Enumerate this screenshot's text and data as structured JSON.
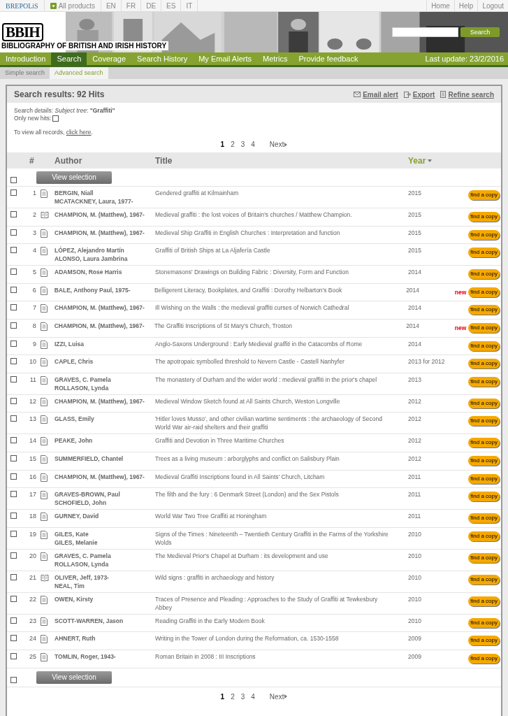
{
  "topbar": {
    "brand": "BREPOLiS",
    "products": "All products",
    "languages": [
      {
        "code": "EN",
        "selected": false
      },
      {
        "code": "FR",
        "selected": false
      },
      {
        "code": "DE",
        "selected": false
      },
      {
        "code": "ES",
        "selected": false
      },
      {
        "code": "IT",
        "selected": false
      }
    ],
    "links": [
      "Home",
      "Help",
      "Logout"
    ]
  },
  "banner": {
    "logo": "BBIH",
    "title": "BIBLIOGRAPHY OF BRITISH AND IRISH HISTORY",
    "search_button": "Search"
  },
  "nav": {
    "items": [
      {
        "label": "Introduction",
        "selected": false
      },
      {
        "label": "Search",
        "selected": true
      },
      {
        "label": "Coverage",
        "selected": false
      },
      {
        "label": "Search History",
        "selected": false
      },
      {
        "label": "My Email Alerts",
        "selected": false
      },
      {
        "label": "Metrics",
        "selected": false
      },
      {
        "label": "Provide feedback",
        "selected": false
      }
    ],
    "last_update": "Last update: 23/2/2016"
  },
  "subnav": [
    {
      "label": "Simple search",
      "selected": false
    },
    {
      "label": "Advanced search",
      "selected": true
    }
  ],
  "results": {
    "title": "Search results: 92 Hits",
    "actions": [
      {
        "kind": "mail",
        "label": "Email alert"
      },
      {
        "kind": "export",
        "label": "Export"
      },
      {
        "kind": "refine",
        "label": "Refine search"
      }
    ],
    "details": "Search details: *Subject tree*: **\"Graffiti\"**",
    "only_new_label": "Only new hits:",
    "only_new": false,
    "view_all": "To view all records, ",
    "view_all_link": "click here",
    "view_all_end": ".",
    "pages": [
      {
        "label": "1",
        "selected": true
      },
      {
        "label": "2",
        "selected": false
      },
      {
        "label": "3",
        "selected": false
      },
      {
        "label": "4",
        "selected": false
      }
    ],
    "next": "Next",
    "columns": [
      {
        "label": "#",
        "sorted": false
      },
      {
        "label": "Author",
        "sorted": false
      },
      {
        "label": "Title",
        "sorted": false
      },
      {
        "label": "Year",
        "sorted": true
      }
    ],
    "view_selection": "View selection",
    "view_selection_bottom": "View selection",
    "rows": [
      {
        "num": "1",
        "kind": "article",
        "checked": false,
        "authors": [
          "BERGIN, Niall",
          "MCATACKNEY, Laura, 1977-"
        ],
        "title": "Gendered graffiti at Kilmainham",
        "year": "2015",
        "button": "find a copy"
      },
      {
        "num": "2",
        "kind": "book",
        "checked": false,
        "authors": [
          "CHAMPION, M. (Matthew), 1967-"
        ],
        "title": "Medieval graffiti : the lost voices of Britain's churches / Matthew Champion.",
        "year": "2015",
        "button": "find a copy"
      },
      {
        "num": "3",
        "kind": "article",
        "checked": false,
        "authors": [
          "CHAMPION, M. (Matthew), 1967-"
        ],
        "title": "Medieval Ship Graffiti in English Churches : Interpretation and function",
        "year": "2015",
        "button": "find a copy"
      },
      {
        "num": "4",
        "kind": "article",
        "checked": false,
        "authors": [
          "LÓPEZ, Alejandro Martín",
          "ALONSO, Laura Jambrina"
        ],
        "title": "Graffiti of British Ships at La Aljafería Castle",
        "year": "2015",
        "button": "find a copy"
      },
      {
        "num": "5",
        "kind": "article",
        "checked": false,
        "authors": [
          "ADAMSON, Rose Harris"
        ],
        "title": "Stonemasons' Drawings on Building Fabric : Diversity, Form and Function",
        "year": "2014",
        "button": "find a copy"
      },
      {
        "num": "6",
        "kind": "article",
        "checked": false,
        "authors": [
          "BALE, Anthony Paul, 1975-"
        ],
        "title": "Belligerent Literacy, Bookplates, and Graffiti : Dorothy Helbarton's Book",
        "year": "2014",
        "badge": "new",
        "button": "find a copy"
      },
      {
        "num": "7",
        "kind": "article",
        "checked": false,
        "authors": [
          "CHAMPION, M. (Matthew), 1967-"
        ],
        "title": "Ill Wishing on the Walls : the medieval graffiti curses of Norwich Cathedral",
        "year": "2014",
        "button": "find a copy"
      },
      {
        "num": "8",
        "kind": "article",
        "checked": false,
        "authors": [
          "CHAMPION, M. (Matthew), 1967-"
        ],
        "title": "The Graffiti Inscriptions of St Mary's Church, Troston",
        "year": "2014",
        "badge": "new",
        "button": "find a copy"
      },
      {
        "num": "9",
        "kind": "article",
        "checked": false,
        "authors": [
          "IZZI, Luisa"
        ],
        "title": "Anglo-Saxons Underground : Early Medieval *graffiti* in the Catacombs of Rome",
        "year": "2014",
        "button": "find a copy"
      },
      {
        "num": "10",
        "kind": "article",
        "checked": false,
        "authors": [
          "CAPLE, Chris"
        ],
        "title": "The apotropaic symbolled threshold to Nevern Castle - Castell Nanhyfer",
        "year": "2013 for 2012",
        "button": "find a copy"
      },
      {
        "num": "11",
        "kind": "article",
        "checked": false,
        "authors": [
          "GRAVES, C. Pamela",
          "ROLLASON, Lynda"
        ],
        "title": "The monastery of Durham and the wider world : medieval graffiti in the prior's chapel",
        "year": "2013",
        "button": "find a copy"
      },
      {
        "num": "12",
        "kind": "article",
        "checked": false,
        "authors": [
          "CHAMPION, M. (Matthew), 1967-"
        ],
        "title": "Medieval Window Sketch found at All Saints Church, Weston Longville",
        "year": "2012",
        "button": "find a copy"
      },
      {
        "num": "13",
        "kind": "article",
        "checked": false,
        "authors": [
          "GLASS, Emily"
        ],
        "title": "'Hitler loves Musso', and other civilian wartime sentiments : the archaeology of Second World War air-raid shelters and their graffiti",
        "year": "2012",
        "button": "find a copy"
      },
      {
        "num": "14",
        "kind": "article",
        "checked": false,
        "authors": [
          "PEAKE, John"
        ],
        "title": "Graffiti and Devotion in Three Maritime Churches",
        "year": "2012",
        "button": "find a copy"
      },
      {
        "num": "15",
        "kind": "article",
        "checked": false,
        "authors": [
          "SUMMERFIELD, Chantel"
        ],
        "title": "Trees as a living museum : arborglyphs and conflict on Salisbury Plain",
        "year": "2012",
        "button": "find a copy"
      },
      {
        "num": "16",
        "kind": "article",
        "checked": false,
        "authors": [
          "CHAMPION, M. (Matthew), 1967-"
        ],
        "title": "Medieval Graffiti Inscriptions found in All Saints' Church, Litcham",
        "year": "2011",
        "button": "find a copy"
      },
      {
        "num": "17",
        "kind": "article",
        "checked": false,
        "authors": [
          "GRAVES-BROWN, Paul",
          "SCHOFIELD, John"
        ],
        "title": "The filth and the fury : 6 Denmark Street (London) and the Sex Pistols",
        "year": "2011",
        "button": "find a copy"
      },
      {
        "num": "18",
        "kind": "article",
        "checked": false,
        "authors": [
          "GURNEY, David"
        ],
        "title": "World War Two Tree Graffiti at Honingham",
        "year": "2011",
        "button": "find a copy"
      },
      {
        "num": "19",
        "kind": "article",
        "checked": false,
        "authors": [
          "GILES, Kate",
          "GILES, Melanie"
        ],
        "title": "Signs of the Times : Nineteenth – Twentieth Century Graffiti in the Farms of the Yorkshire Wolds",
        "year": "2010",
        "button": "find a copy"
      },
      {
        "num": "20",
        "kind": "article",
        "checked": false,
        "authors": [
          "GRAVES, C. Pamela",
          "ROLLASON, Lynda"
        ],
        "title": "The Medieval Prior's Chapel at Durham : its development and use",
        "year": "2010",
        "button": "find a copy"
      },
      {
        "num": "21",
        "kind": "book",
        "checked": false,
        "authors": [
          "OLIVER, Jeff, 1973-",
          "NEAL, Tim"
        ],
        "title": "Wild signs : graffiti in archaeology and history",
        "year": "2010",
        "button": "find a copy"
      },
      {
        "num": "22",
        "kind": "article",
        "checked": false,
        "authors": [
          "OWEN, Kirsty"
        ],
        "title": "Traces of Presence and Pleading : Approaches to the Study of Graffiti at Tewkesbury Abbey",
        "year": "2010",
        "button": "find a copy"
      },
      {
        "num": "23",
        "kind": "article",
        "checked": false,
        "authors": [
          "SCOTT-WARREN, Jason"
        ],
        "title": "Reading Graffiti in the Early Modern Book",
        "year": "2010",
        "button": "find a copy"
      },
      {
        "num": "24",
        "kind": "article",
        "checked": false,
        "authors": [
          "AHNERT, Ruth"
        ],
        "title": "Writing in the Tower of London during the Reformation, ca. 1530-1558",
        "year": "2009",
        "button": "find a copy"
      },
      {
        "num": "25",
        "kind": "article",
        "checked": false,
        "authors": [
          "TOMLIN, Roger, 1943-"
        ],
        "title": "Roman Britain in 2008 : III Inscriptions",
        "year": "2009",
        "button": "find a copy"
      }
    ],
    "select_all_top": false,
    "select_all_bottom": false,
    "pages_bottom": [
      {
        "label": "1",
        "selected": true
      },
      {
        "label": "2",
        "selected": false
      },
      {
        "label": "3",
        "selected": false
      },
      {
        "label": "4",
        "selected": false
      }
    ],
    "next_bottom": "Next"
  }
}
